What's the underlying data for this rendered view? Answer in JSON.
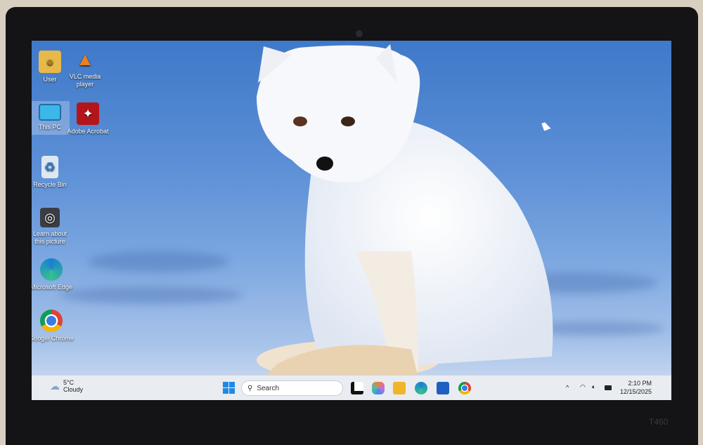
{
  "desktop_icons": [
    {
      "label": "User",
      "icon": "folder-user-icon"
    },
    {
      "label": "VLC media player",
      "icon": "vlc-icon"
    },
    {
      "label": "This PC",
      "icon": "monitor-icon"
    },
    {
      "label": "Adobe Acrobat",
      "icon": "acrobat-icon"
    },
    {
      "label": "Recycle Bin",
      "icon": "recycle-bin-icon"
    },
    {
      "label": "Learn about this picture",
      "icon": "learn-picture-icon"
    },
    {
      "label": "Microsoft Edge",
      "icon": "edge-icon"
    },
    {
      "label": "Google Chrome",
      "icon": "chrome-icon"
    }
  ],
  "weather": {
    "temp": "5°C",
    "condition": "Cloudy"
  },
  "taskbar": {
    "search_label": "Search",
    "apps": [
      "start-icon",
      "widgets-icon",
      "copilot-icon",
      "file-explorer-icon",
      "edge-icon",
      "store-icon",
      "chrome-icon"
    ]
  },
  "tray": {
    "time": "2:10 PM",
    "date": "12/15/2025"
  },
  "bezel": {
    "model": "T460"
  }
}
